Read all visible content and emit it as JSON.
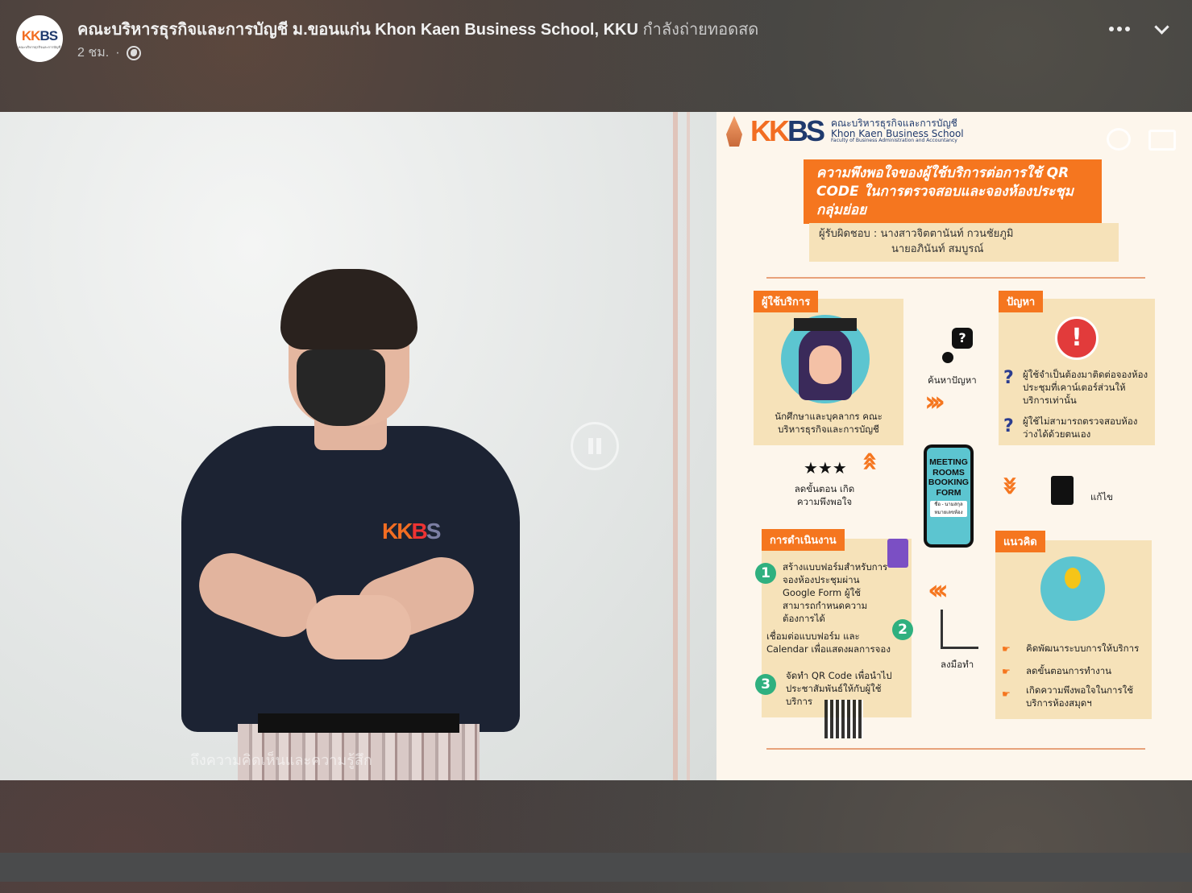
{
  "post": {
    "page_name": "คณะบริหารธุรกิจและการบัญชี ม.ขอนแก่น Khon Kaen Business School, KKU",
    "status": "กำลังถ่ายทอดสด",
    "time": "2 ชม.",
    "separator": "·",
    "avatar_logo": "KKBS",
    "avatar_sub": "คณะบริหารธุรกิจและการบัญชี"
  },
  "video": {
    "shirt_logo": [
      "KK",
      "B",
      "S"
    ],
    "caption": "ถึงความคิดเห็นและความรู้สึก"
  },
  "poster": {
    "logo": [
      "KK",
      "BS"
    ],
    "school_th": "คณะบริหารธุรกิจและการบัญชี",
    "school_en": "Khon Kaen Business School",
    "school_sub": "Faculty of Business Administration and Accountancy",
    "title": "ความพึงพอใจของผู้ใช้บริการต่อการใช้ QR CODE ในการตรวจสอบและจองห้องประชุมกลุ่มย่อย",
    "responsible_1": "ผู้รับผิดชอบ : นางสาวจิตตานันท์ กวนชัยภูมิ",
    "responsible_2": "นายอภินันท์ สมบูรณ์",
    "users_tag": "ผู้ใช้บริการ",
    "users_text": "นักศึกษาและบุคลากร คณะบริหารธุรกิจและการบัญชี",
    "find_problem": "ค้นหาปัญหา",
    "problem_tag": "ปัญหา",
    "problem_1": "ผู้ใช้จำเป็นต้องมาติดต่อจองห้องประชุมที่เคาน์เตอร์ส่วนให้บริการเท่านั้น",
    "problem_2": "ผู้ใช้ไม่สามารถตรวจสอบห้องว่างได้ด้วยตนเอง",
    "satisfaction": "ลดขั้นตอน เกิดความพึงพอใจ",
    "phone_form": "MEETING ROOMS BOOKING FORM",
    "phone_field_1": "ชื่อ - นามสกุล",
    "phone_field_2": "หมายเลขห้อง",
    "fix": "แก้ไข",
    "ops_tag": "การดำเนินงาน",
    "step_1": "สร้างแบบฟอร์มสำหรับการจองห้องประชุมผ่าน Google Form ผู้ใช้สามารถกำหนดความต้องการได้",
    "step_2": "เชื่อมต่อแบบฟอร์ม และ Calendar เพื่อแสดงผลการจอง",
    "step_3": "จัดทำ QR Code เพื่อนำไปประชาสัมพันธ์ให้กับผู้ใช้บริการ",
    "do_it": "ลงมือทำ",
    "idea_tag": "แนวคิด",
    "idea_1": "คิดพัฒนาระบบการให้บริการ",
    "idea_2": "ลดขั้นตอนการทำงาน",
    "idea_3": "เกิดความพึงพอใจในการใช้บริการห้องสมุดฯ",
    "stars": "★★★",
    "n1": "1",
    "n2": "2",
    "n3": "3"
  },
  "icons": [
    "globe-icon",
    "more-icon",
    "chevron-down-icon",
    "pause-icon",
    "chat-icon",
    "cast-icon"
  ],
  "colors": {
    "accent": "#f5761f",
    "panel": "#f6e2b9",
    "navy": "#1f3a6d",
    "green": "#2fb07f"
  }
}
